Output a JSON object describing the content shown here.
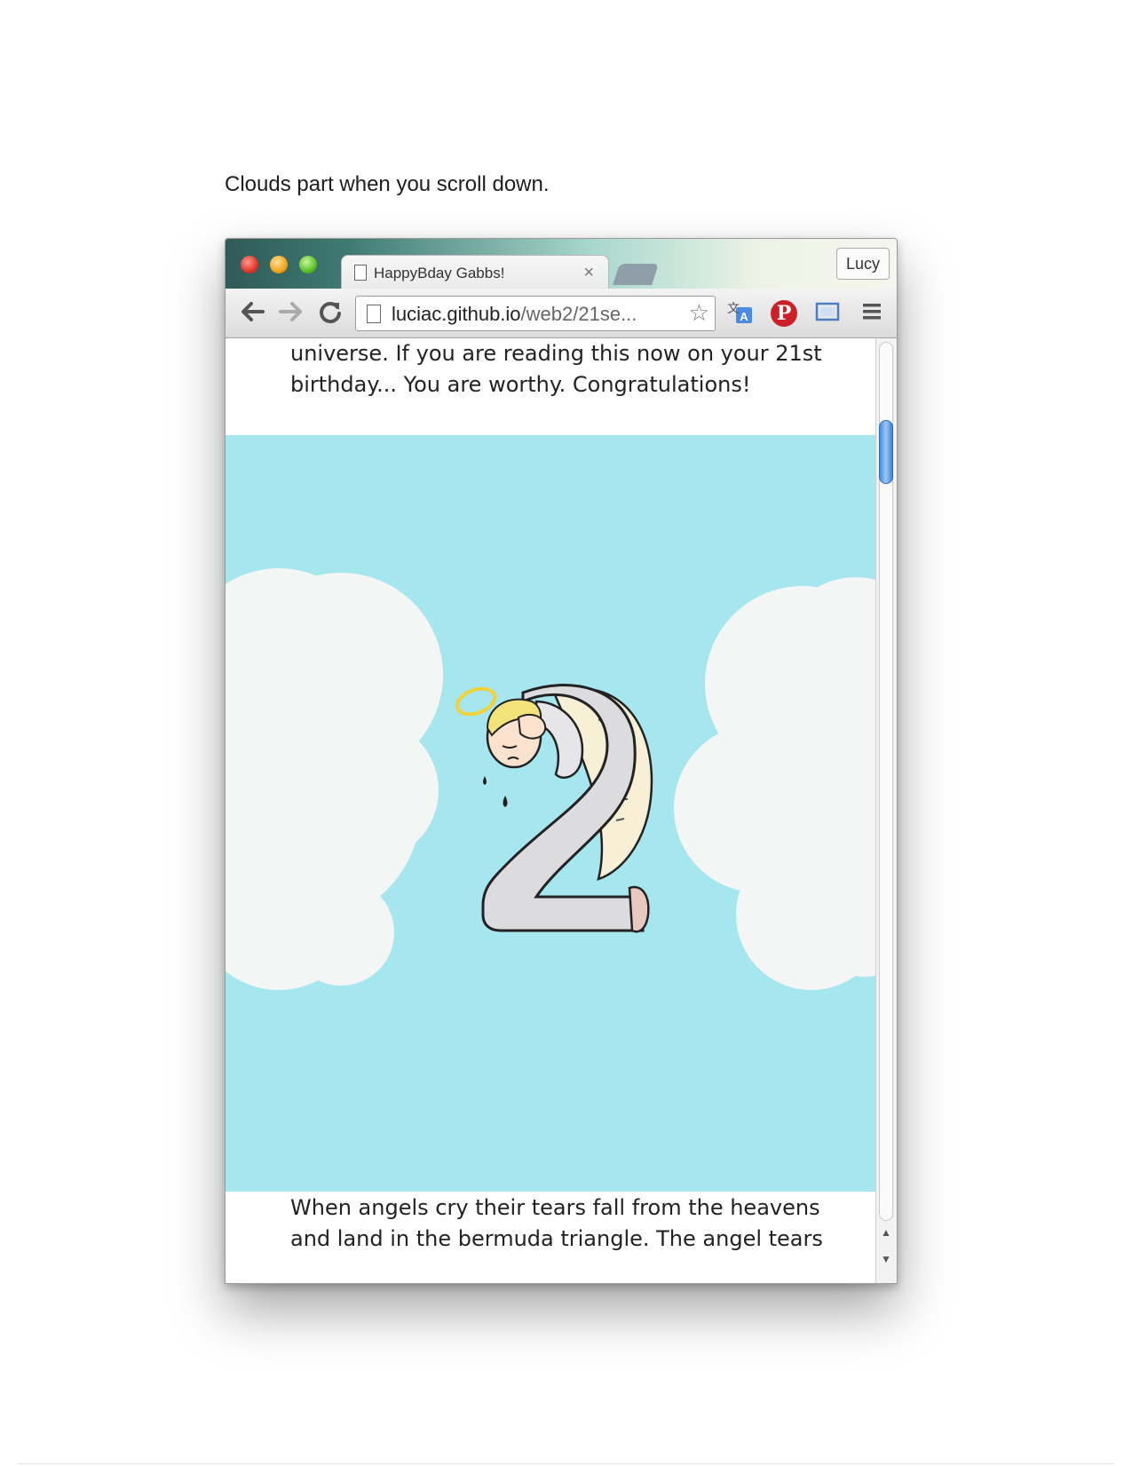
{
  "caption": "Clouds part when you scroll down.",
  "browser": {
    "tab_title": "HappyBday Gabbs!",
    "tab_close": "×",
    "user_name": "Lucy",
    "url_host": "luciac.github.io",
    "url_path": "/web2/21se...",
    "icons": {
      "back": "arrow-left",
      "forward": "arrow-right",
      "reload": "reload",
      "bookmark": "star",
      "translate": "translate",
      "pinterest": "pinterest",
      "screen": "screen-capture",
      "menu": "hamburger"
    },
    "pinterest_glyph": "P"
  },
  "page": {
    "text_top_line1": "universe. If you are reading this now on your 21st",
    "text_top_line2": "birthday... You are worthy. Congratulations!",
    "text_bottom_line1": "When angels cry their tears fall from the heavens",
    "text_bottom_line2": "and land in the bermuda triangle. The angel tears",
    "illustration": "crying-angel-number-2",
    "sky_color": "#a6e6ef",
    "cloud_color": "#f4f6f5"
  }
}
